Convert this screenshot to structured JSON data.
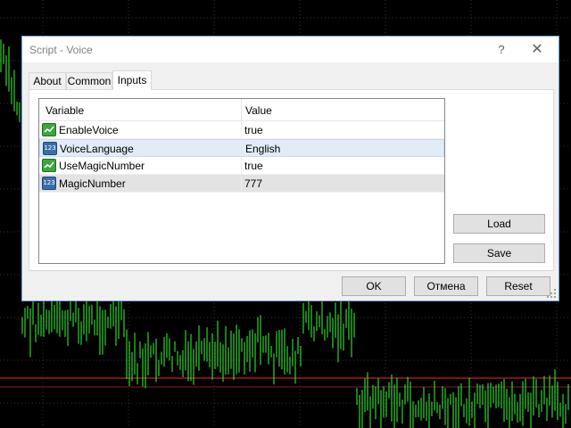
{
  "dialog": {
    "title": "Script - Voice",
    "help_label": "?",
    "close_label": "✕"
  },
  "tabs": [
    {
      "label": "About",
      "active": false
    },
    {
      "label": "Common",
      "active": false
    },
    {
      "label": "Inputs",
      "active": true
    }
  ],
  "grid": {
    "columns": [
      "Variable",
      "Value"
    ],
    "rows": [
      {
        "icon": "bool-icon",
        "name": "EnableVoice",
        "value": "true"
      },
      {
        "icon": "number-icon",
        "name": "VoiceLanguage",
        "value": "English"
      },
      {
        "icon": "bool-icon",
        "name": "UseMagicNumber",
        "value": "true"
      },
      {
        "icon": "number-icon",
        "name": "MagicNumber",
        "value": "777"
      }
    ],
    "number_icon_text": "123"
  },
  "side_buttons": {
    "load": "Load",
    "save": "Save"
  },
  "footer": {
    "ok": "OK",
    "cancel": "Отмена",
    "reset": "Reset"
  },
  "colors": {
    "chart_background": "#000000",
    "candle_color": "#33ff33",
    "price_line": "#ff2020",
    "selected_row": "#e1ecf7"
  }
}
